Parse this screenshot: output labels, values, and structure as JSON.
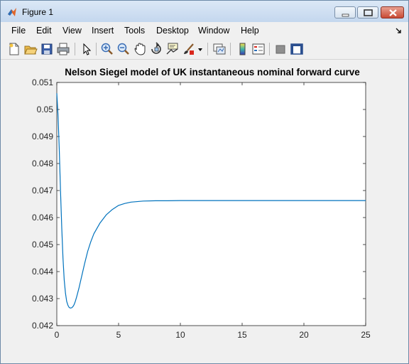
{
  "window": {
    "title": "Figure 1"
  },
  "menu": {
    "items": [
      "File",
      "Edit",
      "View",
      "Insert",
      "Tools",
      "Desktop",
      "Window",
      "Help"
    ]
  },
  "toolbar": {
    "icons": [
      "new-figure-icon",
      "open-file-icon",
      "save-icon",
      "print-icon",
      "edit-plot-arrow-icon",
      "zoom-in-icon",
      "zoom-out-icon",
      "pan-hand-icon",
      "rotate-3d-icon",
      "data-cursor-icon",
      "brush-icon",
      "brush-dropdown-icon",
      "link-plot-icon",
      "colorbar-icon",
      "legend-icon",
      "hide-plot-tools-icon",
      "show-plot-tools-icon"
    ]
  },
  "colors": {
    "line": "#0072bd",
    "axes_bg": "#ffffff",
    "frame": "#262626"
  },
  "chart_data": {
    "type": "line",
    "title": "Nelson Siegel model of UK instantaneous nominal forward curve",
    "xlabel": "",
    "ylabel": "",
    "xlim": [
      0,
      25
    ],
    "ylim": [
      0.042,
      0.051
    ],
    "xticks": [
      0,
      5,
      10,
      15,
      20,
      25
    ],
    "yticks": [
      0.042,
      0.043,
      0.044,
      0.045,
      0.046,
      0.047,
      0.048,
      0.049,
      0.05,
      0.051
    ],
    "ytick_labels": [
      "0.042",
      "0.043",
      "0.044",
      "0.045",
      "0.046",
      "0.047",
      "0.048",
      "0.049",
      "0.05",
      "0.051"
    ],
    "grid": false,
    "series": [
      {
        "x": [
          0,
          0.1,
          0.2,
          0.3,
          0.4,
          0.5,
          0.6,
          0.7,
          0.8,
          0.9,
          1.0,
          1.1,
          1.2,
          1.3,
          1.4,
          1.5,
          1.6,
          1.8,
          2.0,
          2.25,
          2.5,
          2.75,
          3.0,
          3.5,
          4.0,
          4.5,
          5.0,
          5.5,
          6.0,
          7.0,
          8.0,
          9.0,
          10,
          12,
          15,
          20,
          25
        ],
        "y": [
          0.0506,
          0.0498,
          0.0485,
          0.047,
          0.0456,
          0.0445,
          0.0437,
          0.0432,
          0.0429,
          0.04275,
          0.04267,
          0.04265,
          0.04266,
          0.0427,
          0.04278,
          0.0429,
          0.04305,
          0.0434,
          0.0438,
          0.0443,
          0.04475,
          0.0451,
          0.0454,
          0.0458,
          0.0461,
          0.0463,
          0.04645,
          0.04652,
          0.04657,
          0.04661,
          0.04662,
          0.04662,
          0.04663,
          0.04663,
          0.04663,
          0.04663,
          0.04663
        ]
      }
    ]
  }
}
